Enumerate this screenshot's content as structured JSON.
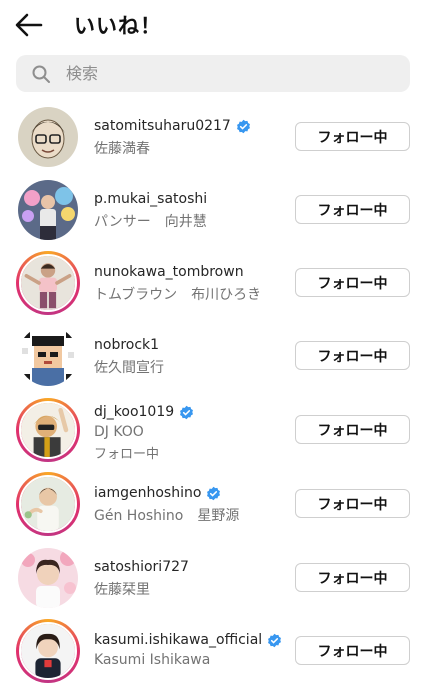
{
  "header": {
    "title": "いいね！"
  },
  "search": {
    "placeholder": "検索"
  },
  "colors": {
    "verified": "#3897f0",
    "story_ring_start": "#f9a825",
    "story_ring_end": "#c13584"
  },
  "users": [
    {
      "username": "satomitsuharu0217",
      "verified": true,
      "fullname": "佐藤満春",
      "button": "フォロー中"
    },
    {
      "username": "p.mukai_satoshi",
      "verified": false,
      "fullname": "パンサー　向井慧",
      "button": "フォロー中"
    },
    {
      "username": "nunokawa_tombrown",
      "verified": false,
      "fullname": "トムブラウン　布川ひろき",
      "button": "フォロー中"
    },
    {
      "username": "nobrock1",
      "verified": false,
      "fullname": "佐久間宣行",
      "button": "フォロー中"
    },
    {
      "username": "dj_koo1019",
      "verified": true,
      "fullname": "DJ KOO",
      "subtext": "フォロー中",
      "button": "フォロー中"
    },
    {
      "username": "iamgenhoshino",
      "verified": true,
      "fullname": "Gén Hoshino　星野源",
      "button": "フォロー中"
    },
    {
      "username": "satoshiori727",
      "verified": false,
      "fullname": "佐藤栞里",
      "button": "フォロー中"
    },
    {
      "username": "kasumi.ishikawa_official",
      "verified": true,
      "fullname": "Kasumi Ishikawa",
      "button": "フォロー中"
    }
  ]
}
